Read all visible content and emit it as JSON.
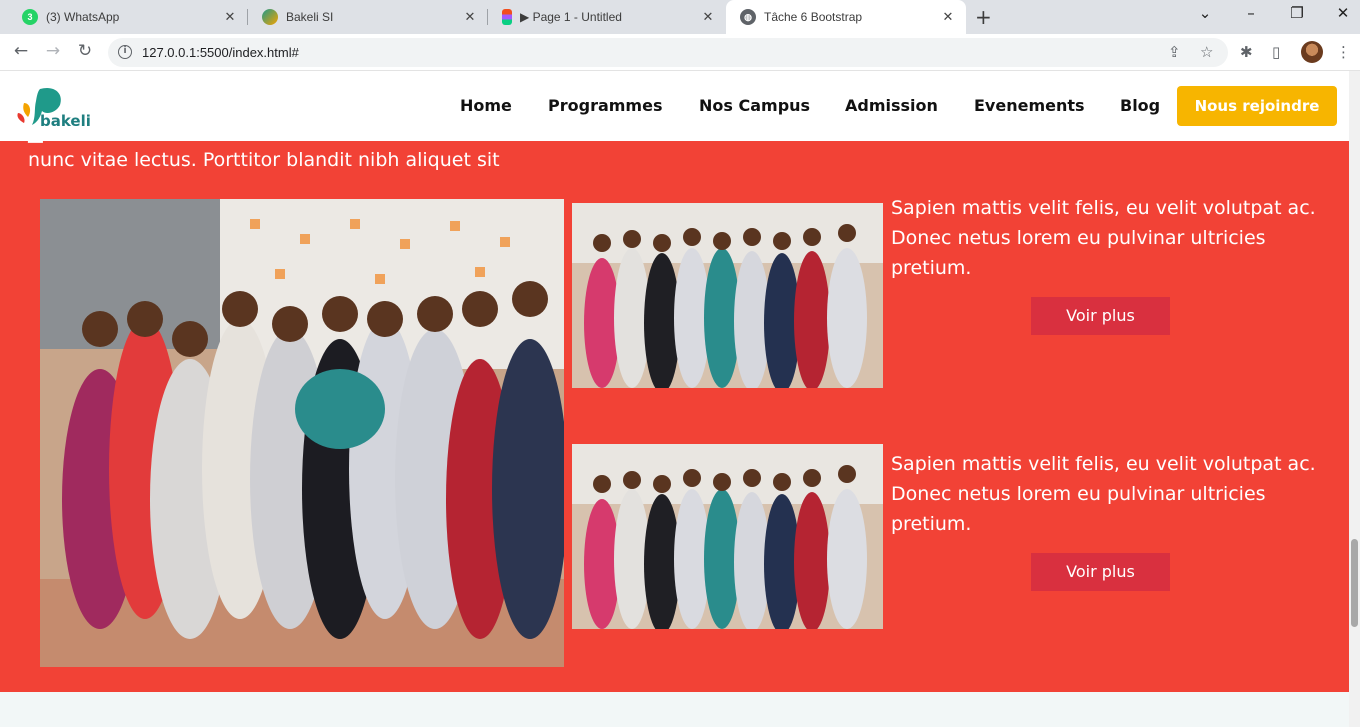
{
  "browser": {
    "tabs": [
      {
        "title": "(3) WhatsApp",
        "badge": "3",
        "active": false
      },
      {
        "title": "Bakeli SI",
        "active": false
      },
      {
        "title": "▶ Page 1 - Untitled",
        "active": false
      },
      {
        "title": "Tâche 6 Bootstrap",
        "active": true
      }
    ],
    "url": "127.0.0.1:5500/index.html#"
  },
  "site": {
    "logo_text": "bakeli",
    "nav": [
      "Home",
      "Programmes",
      "Nos Campus",
      "Admission",
      "Evenements",
      "Blog"
    ],
    "cta": "Nous rejoindre"
  },
  "section": {
    "lead": "nunc vitae lectus. Porttitor blandit nibh aliquet sit",
    "cards": [
      {
        "text": "Sapien mattis velit felis, eu velit volutpat ac. Donec netus lorem eu pulvinar ultricies pretium.",
        "button": "Voir plus"
      },
      {
        "text": "Sapien mattis velit felis, eu velit volutpat ac. Donec netus lorem eu pulvinar ultricies pretium.",
        "button": "Voir plus"
      }
    ]
  },
  "colors": {
    "section_bg": "#f24236",
    "cta": "#f7b500",
    "voir_btn": "#d9303f",
    "logo": "#1f7f80"
  }
}
